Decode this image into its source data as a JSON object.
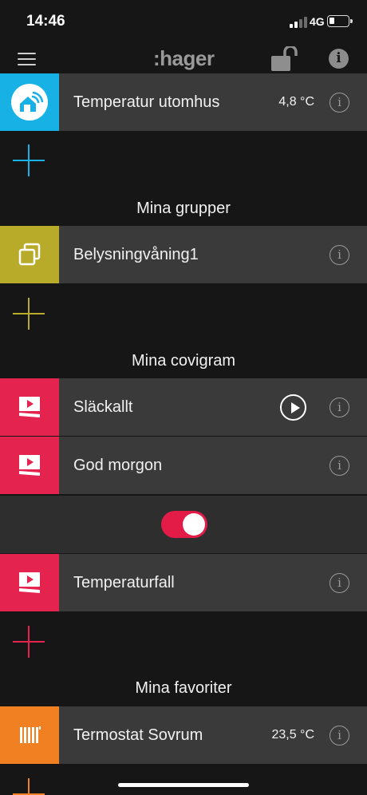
{
  "status_bar": {
    "time": "14:46",
    "network": "4G"
  },
  "header": {
    "logo": ":hager",
    "info_glyph": "i"
  },
  "colors": {
    "sensor": "#17b1e5",
    "group": "#b8ab2a",
    "scene": "#e5234f",
    "thermostat": "#f08022",
    "background": "#161616",
    "row": "#3a3a3a"
  },
  "sensor_row": {
    "label": "Temperatur utomhus",
    "value": "4,8 °C",
    "icon": "wifi-house-icon"
  },
  "groups": {
    "title": "Mina grupper",
    "items": [
      {
        "label": "Belysningvåning1",
        "icon": "copy-squares-icon"
      }
    ]
  },
  "covigram": {
    "title": "Mina covigram",
    "items": [
      {
        "label": "Släckallt",
        "icon": "scene-play-icon"
      },
      {
        "label": "God morgon",
        "icon": "scene-play-icon"
      },
      {
        "label": "Temperaturfall",
        "icon": "scene-play-icon"
      }
    ],
    "toggle_on": true
  },
  "favorites": {
    "title": "Mina favoriter",
    "items": [
      {
        "label": "Termostat Sovrum",
        "value": "23,5 °C",
        "icon": "radiator-icon"
      }
    ]
  },
  "row_info_glyph": "i"
}
